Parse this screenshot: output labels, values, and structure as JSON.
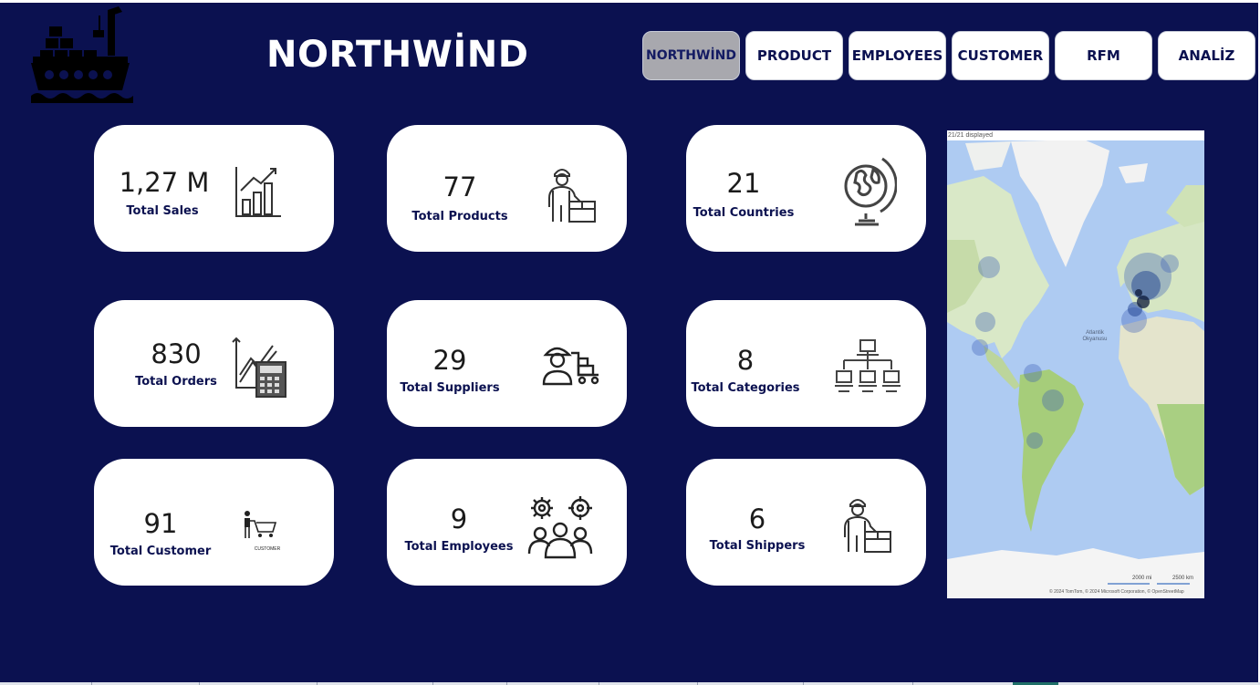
{
  "header": {
    "title": "NORTHWİND"
  },
  "nav": {
    "buttons": [
      {
        "label": "NORTHWİND",
        "active": true
      },
      {
        "label": "PRODUCT",
        "active": false
      },
      {
        "label": "EMPLOYEES",
        "active": false
      },
      {
        "label": "CUSTOMER",
        "active": false
      },
      {
        "label": "RFM",
        "active": false
      },
      {
        "label": "ANALİZ",
        "active": false
      }
    ]
  },
  "cards": [
    {
      "value": "1,27 M",
      "label": "Total Sales",
      "icon": "bar-growth-chart-icon"
    },
    {
      "value": "77",
      "label": "Total Products",
      "icon": "worker-with-box-icon"
    },
    {
      "value": "21",
      "label": "Total Countries",
      "icon": "globe-icon"
    },
    {
      "value": "830",
      "label": "Total Orders",
      "icon": "chart-calculator-icon"
    },
    {
      "value": "29",
      "label": "Total Suppliers",
      "icon": "supplier-cart-icon"
    },
    {
      "value": "8",
      "label": "Total Categories",
      "icon": "hierarchy-icon"
    },
    {
      "value": "91",
      "label": "Total Customer",
      "icon": "shopping-cart-customer-icon",
      "icon_caption": "CUSTOMER"
    },
    {
      "value": "9",
      "label": "Total Employees",
      "icon": "team-gears-icon"
    },
    {
      "value": "6",
      "label": "Total Shippers",
      "icon": "worker-with-box-icon"
    }
  ],
  "map": {
    "status": "21/21 displayed",
    "ocean_label": "Atlantik Okyanusu",
    "scale_mi": "2000 mi",
    "scale_km": "2500 km",
    "attribution": "© 2024 TomTom, © 2024 Microsoft Corporation, © OpenStreetMap"
  },
  "colors": {
    "background": "#0b1150",
    "card": "#ffffff",
    "label": "#0b1150",
    "nav_active": "#a8a8ae",
    "heat": "#1d3f8f"
  }
}
